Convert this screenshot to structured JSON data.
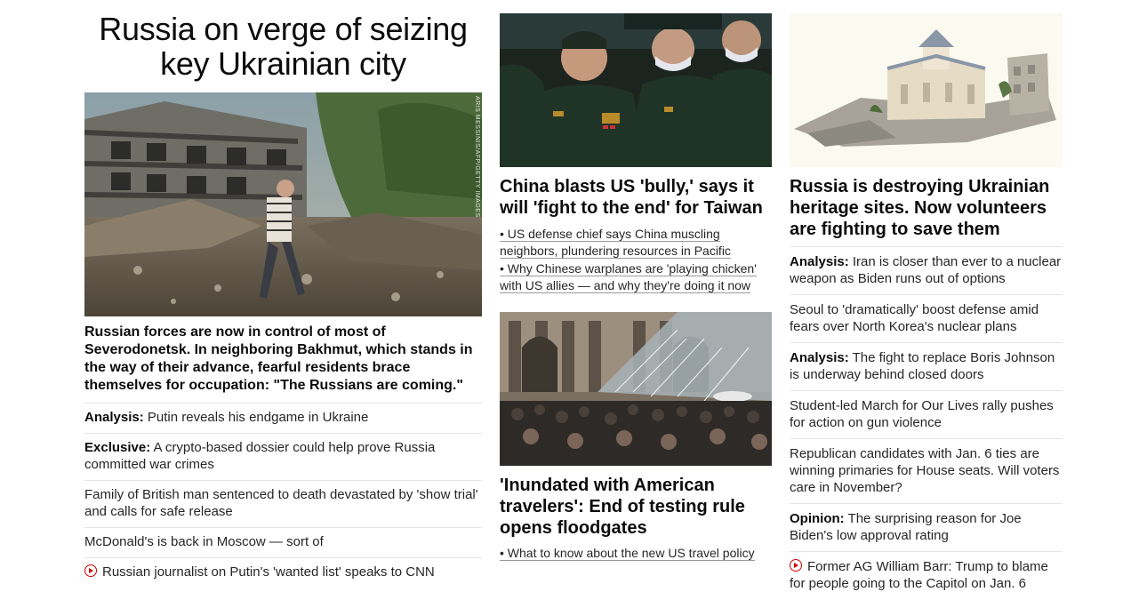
{
  "col1": {
    "headline": "Russia on verge of seizing key Ukrainian city",
    "image_alt": "Man walking past destroyed building in Ukraine",
    "image_credit": "ARIS MESSINIS/AFP/GETTY IMAGES",
    "summary": "Russian forces are now in control of most of Severodonetsk. In neighboring Bakhmut, which stands in the way of their advance, fearful residents brace themselves for occupation: \"The Russians are coming.\"",
    "items": [
      {
        "prefix": "Analysis:",
        "text": " Putin reveals his endgame in Ukraine"
      },
      {
        "prefix": "Exclusive:",
        "text": " A crypto-based dossier could help prove Russia committed war crimes"
      },
      {
        "prefix": "",
        "text": "Family of British man sentenced to death devastated by 'show trial' and calls for safe release"
      },
      {
        "prefix": "",
        "text": "McDonald's is back in Moscow — sort of"
      },
      {
        "prefix": "",
        "text": "Russian journalist on Putin's 'wanted list' speaks to CNN",
        "video": true
      }
    ]
  },
  "col2": {
    "story1": {
      "image_alt": "Chinese military officials wearing face masks",
      "title": "China blasts US 'bully,' says it will 'fight to the end' for Taiwan",
      "bullets": [
        "• US defense chief says China muscling neighbors, plundering resources in Pacific",
        "• Why Chinese warplanes are 'playing chicken' with US allies — and why they're doing it now"
      ]
    },
    "story2": {
      "image_alt": "Crowds of tourists at the Louvre pyramid",
      "title": "'Inundated with American travelers': End of testing rule opens floodgates",
      "bullets": [
        "• What to know about the new US travel policy"
      ]
    }
  },
  "col3": {
    "image_alt": "3D scan of a Ukrainian church",
    "title": "Russia is destroying Ukrainian heritage sites. Now volunteers are fighting to save them",
    "items": [
      {
        "prefix": "Analysis:",
        "text": " Iran is closer than ever to a nuclear weapon as Biden runs out of options"
      },
      {
        "prefix": "",
        "text": "Seoul to 'dramatically' boost defense amid fears over North Korea's nuclear plans"
      },
      {
        "prefix": "Analysis:",
        "text": " The fight to replace Boris Johnson is underway behind closed doors"
      },
      {
        "prefix": "",
        "text": "Student-led March for Our Lives rally pushes for action on gun violence"
      },
      {
        "prefix": "",
        "text": "Republican candidates with Jan. 6 ties are winning primaries for House seats. Will voters care in November?"
      },
      {
        "prefix": "Opinion:",
        "text": " The surprising reason for Joe Biden's low approval rating"
      },
      {
        "prefix": "",
        "text": "Former AG William Barr: Trump to blame for people going to the Capitol on Jan. 6",
        "video": true
      }
    ]
  },
  "colors": {
    "text": "#0c0c0c",
    "video_red": "#cc0000",
    "divider": "#e6e6e6"
  }
}
